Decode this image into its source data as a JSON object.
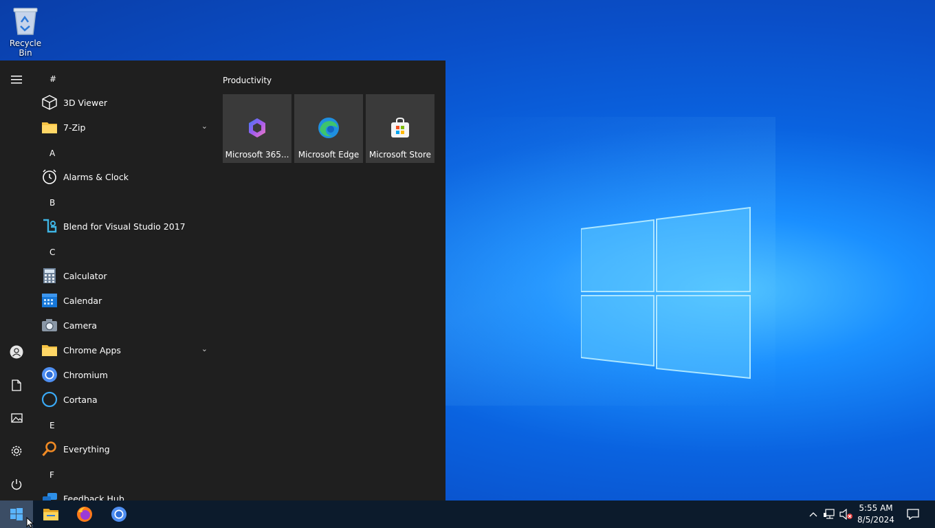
{
  "desktop": {
    "recycle_bin_label": "Recycle Bin"
  },
  "start_menu": {
    "sections": [
      {
        "header": "#",
        "apps": [
          {
            "label": "3D Viewer",
            "icon": "cube-icon"
          },
          {
            "label": "7-Zip",
            "icon": "folder-icon",
            "expandable": true
          }
        ]
      },
      {
        "header": "A",
        "apps": [
          {
            "label": "Alarms & Clock",
            "icon": "alarm-clock-icon"
          }
        ]
      },
      {
        "header": "B",
        "apps": [
          {
            "label": "Blend for Visual Studio 2017",
            "icon": "blend-icon"
          }
        ]
      },
      {
        "header": "C",
        "apps": [
          {
            "label": "Calculator",
            "icon": "calculator-icon"
          },
          {
            "label": "Calendar",
            "icon": "calendar-icon"
          },
          {
            "label": "Camera",
            "icon": "camera-icon"
          },
          {
            "label": "Chrome Apps",
            "icon": "folder-icon",
            "expandable": true
          },
          {
            "label": "Chromium",
            "icon": "chromium-icon"
          },
          {
            "label": "Cortana",
            "icon": "cortana-icon"
          }
        ]
      },
      {
        "header": "E",
        "apps": [
          {
            "label": "Everything",
            "icon": "magnifier-icon"
          }
        ]
      },
      {
        "header": "F",
        "apps": [
          {
            "label": "Feedback Hub",
            "icon": "feedback-icon"
          }
        ]
      }
    ],
    "tile_group": {
      "title": "Productivity",
      "tiles": [
        {
          "label": "Microsoft 365...",
          "icon": "microsoft-365-icon"
        },
        {
          "label": "Microsoft Edge",
          "icon": "edge-icon"
        },
        {
          "label": "Microsoft Store",
          "icon": "store-icon"
        }
      ]
    }
  },
  "taskbar": {
    "time": "5:55 AM",
    "date": "8/5/2024"
  },
  "colors": {
    "menu_bg": "#1f1f1f",
    "tile_bg": "#3a3a3a",
    "taskbar_bg": "#0c1b2c",
    "folder": "#f5c242",
    "accent": "#2a8cff"
  }
}
